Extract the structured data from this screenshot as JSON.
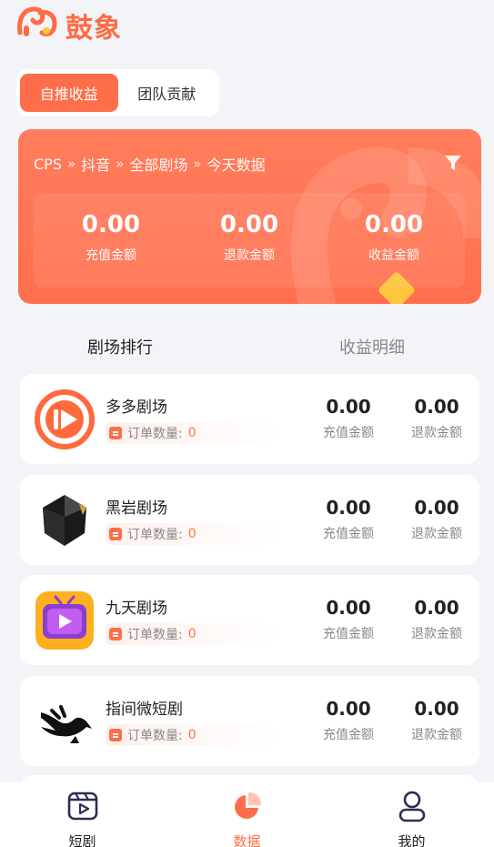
{
  "app": {
    "brand_name": "鼓象",
    "accent": "#ff6e4a"
  },
  "tabs": [
    {
      "label": "自推收益",
      "active": true
    },
    {
      "label": "团队贡献",
      "active": false
    }
  ],
  "summary": {
    "breadcrumb": [
      "CPS",
      "抖音",
      "全部剧场",
      "今天数据"
    ],
    "stats": [
      {
        "value": "0.00",
        "label": "充值金额"
      },
      {
        "value": "0.00",
        "label": "退款金额"
      },
      {
        "value": "0.00",
        "label": "收益金额"
      }
    ]
  },
  "sections": {
    "ranking": "剧场排行",
    "detail": "收益明细"
  },
  "theaters": [
    {
      "name": "多多剧场",
      "orders_label": "订单数量:",
      "orders": "0",
      "recharge": "0.00",
      "recharge_label": "充值金额",
      "refund": "0.00",
      "refund_label": "退款金额",
      "icon": "play-circle-icon"
    },
    {
      "name": "黑岩剧场",
      "orders_label": "订单数量:",
      "orders": "0",
      "recharge": "0.00",
      "recharge_label": "充值金额",
      "refund": "0.00",
      "refund_label": "退款金额",
      "icon": "black-crystal-icon"
    },
    {
      "name": "九天剧场",
      "orders_label": "订单数量:",
      "orders": "0",
      "recharge": "0.00",
      "recharge_label": "充值金额",
      "refund": "0.00",
      "refund_label": "退款金额",
      "icon": "tv-play-icon"
    },
    {
      "name": "指间微短剧",
      "orders_label": "订单数量:",
      "orders": "0",
      "recharge": "0.00",
      "recharge_label": "充值金额",
      "refund": "0.00",
      "refund_label": "退款金额",
      "icon": "bird-hand-icon"
    }
  ],
  "bottom_nav": [
    {
      "label": "短剧",
      "icon": "video-icon",
      "active": false
    },
    {
      "label": "数据",
      "icon": "pie-chart-icon",
      "active": true
    },
    {
      "label": "我的",
      "icon": "user-icon",
      "active": false
    }
  ]
}
